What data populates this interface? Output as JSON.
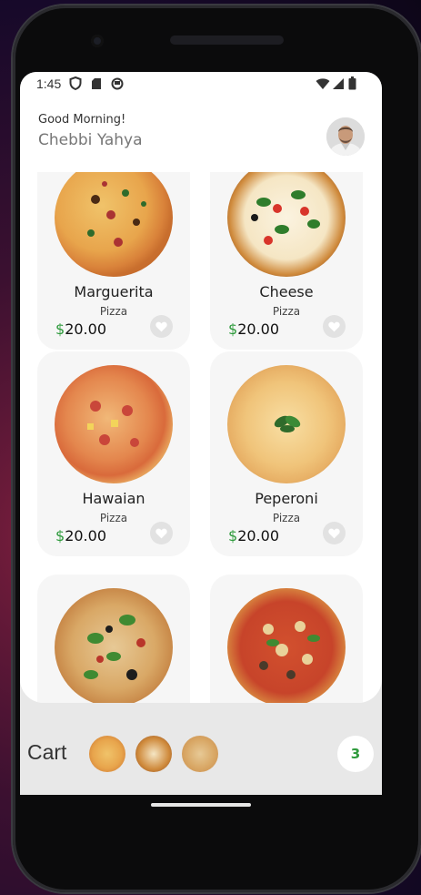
{
  "status": {
    "time": "1:45"
  },
  "header": {
    "greeting": "Good Morning!",
    "user_name": "Chebbi Yahya"
  },
  "products": [
    {
      "name": "Marguerita",
      "category": "Pizza",
      "currency": "$",
      "price": "20.00"
    },
    {
      "name": "Cheese",
      "category": "Pizza",
      "currency": "$",
      "price": "20.00"
    },
    {
      "name": "Hawaian",
      "category": "Pizza",
      "currency": "$",
      "price": "20.00"
    },
    {
      "name": "Peperoni",
      "category": "Pizza",
      "currency": "$",
      "price": "20.00"
    },
    {
      "name": "",
      "category": "",
      "currency": "",
      "price": ""
    },
    {
      "name": "",
      "category": "",
      "currency": "",
      "price": ""
    }
  ],
  "cart": {
    "label": "Cart",
    "count": "3"
  },
  "colors": {
    "accent_green": "#2e9a3c",
    "card_bg": "#f6f6f6",
    "cart_bar_bg": "#e8e8e8"
  },
  "icons": [
    "shield-icon",
    "sim-card-icon",
    "sync-icon",
    "wifi-icon",
    "signal-icon",
    "battery-icon",
    "heart-icon"
  ]
}
